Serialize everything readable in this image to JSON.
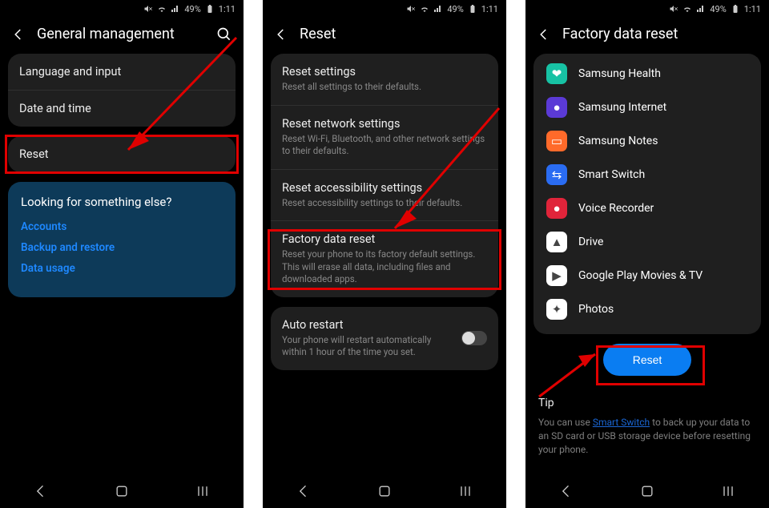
{
  "status": {
    "battery": "49%",
    "time": "1:11"
  },
  "screen1": {
    "title": "General management",
    "items": [
      "Language and input",
      "Date and time",
      "Reset"
    ],
    "help": {
      "question": "Looking for something else?",
      "links": [
        "Accounts",
        "Backup and restore",
        "Data usage"
      ]
    }
  },
  "screen2": {
    "title": "Reset",
    "options": [
      {
        "title": "Reset settings",
        "sub": "Reset all settings to their defaults."
      },
      {
        "title": "Reset network settings",
        "sub": "Reset Wi-Fi, Bluetooth, and other network settings to their defaults."
      },
      {
        "title": "Reset accessibility settings",
        "sub": "Reset accessibility settings to their defaults."
      },
      {
        "title": "Factory data reset",
        "sub": "Reset your phone to its factory default settings. This will erase all data, including files and downloaded apps."
      }
    ],
    "auto": {
      "title": "Auto restart",
      "sub": "Your phone will restart automatically within 1 hour of the time you set."
    }
  },
  "screen3": {
    "title": "Factory data reset",
    "apps": [
      {
        "label": "Samsung Health",
        "bg": "#17c2a4",
        "glyph": "❤"
      },
      {
        "label": "Samsung Internet",
        "bg": "#5b3ad6",
        "glyph": "●"
      },
      {
        "label": "Samsung Notes",
        "bg": "#ff6a2a",
        "glyph": "▭"
      },
      {
        "label": "Smart Switch",
        "bg": "#2a6cf2",
        "glyph": "⇆"
      },
      {
        "label": "Voice Recorder",
        "bg": "#e0243a",
        "glyph": "●"
      },
      {
        "label": "Drive",
        "bg": "#ffffff",
        "glyph": "▲"
      },
      {
        "label": "Google Play Movies & TV",
        "bg": "#ffffff",
        "glyph": "▶"
      },
      {
        "label": "Photos",
        "bg": "#ffffff",
        "glyph": "✦"
      }
    ],
    "reset_label": "Reset",
    "tip_title": "Tip",
    "tip_text_before": "You can use ",
    "tip_link": "Smart Switch",
    "tip_text_after": " to back up your data to an SD card or USB storage device before resetting your phone."
  }
}
